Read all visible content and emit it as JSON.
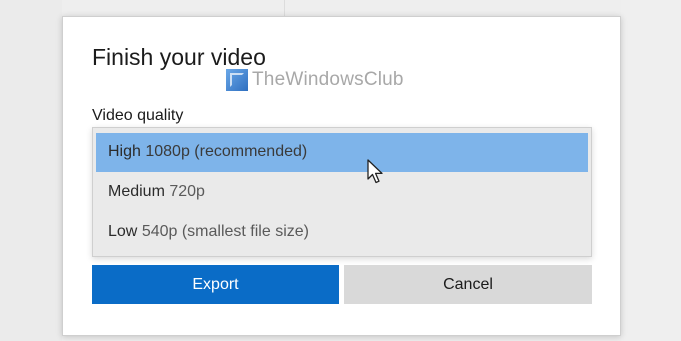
{
  "dialog": {
    "title": "Finish your video",
    "quality_label": "Video quality",
    "options": [
      {
        "name": "High",
        "detail": "1080p (recommended)",
        "selected": true
      },
      {
        "name": "Medium",
        "detail": "720p",
        "selected": false
      },
      {
        "name": "Low",
        "detail": "540p (smallest file size)",
        "selected": false
      }
    ],
    "export_label": "Export",
    "cancel_label": "Cancel"
  },
  "watermark": {
    "text": "TheWindowsClub"
  },
  "colors": {
    "accent": "#0a6cc7",
    "selected_option": "#7eb4ea",
    "dropdown_bg": "#eaeaea",
    "cancel_bg": "#d9d9d9"
  },
  "icons": {
    "watermark_logo": "thewindowsclub-logo-icon",
    "pointer": "mouse-pointer-icon"
  }
}
